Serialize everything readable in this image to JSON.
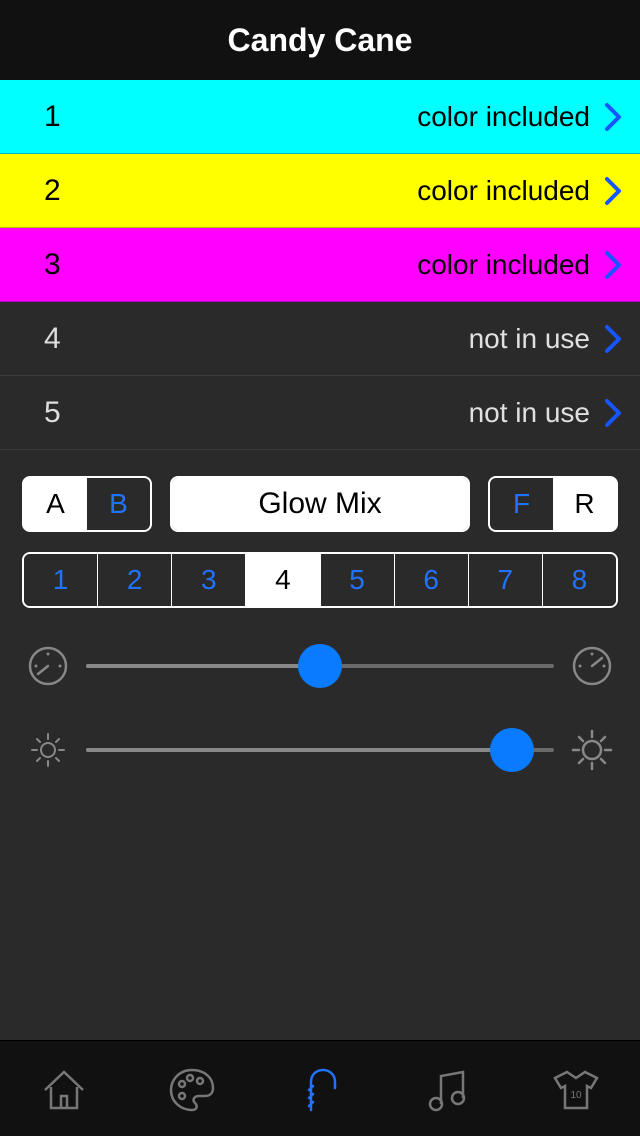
{
  "header": {
    "title": "Candy Cane"
  },
  "colors": {
    "included_label": "color included",
    "not_used_label": "not in use",
    "rows": [
      {
        "n": "1",
        "status": "color included",
        "bg": "#00FFFF",
        "fg": "#000000"
      },
      {
        "n": "2",
        "status": "color included",
        "bg": "#FFFF00",
        "fg": "#000000"
      },
      {
        "n": "3",
        "status": "color included",
        "bg": "#FF00FF",
        "fg": "#000000"
      },
      {
        "n": "4",
        "status": "not in use",
        "bg": "",
        "fg": ""
      },
      {
        "n": "5",
        "status": "not in use",
        "bg": "",
        "fg": ""
      }
    ]
  },
  "segments": {
    "ab": {
      "a": "A",
      "b": "B",
      "selected": "B"
    },
    "mode_label": "Glow Mix",
    "fr": {
      "f": "F",
      "r": "R",
      "selected": "F"
    },
    "numbers": [
      "1",
      "2",
      "3",
      "4",
      "5",
      "6",
      "7",
      "8"
    ],
    "numbers_selected": "4"
  },
  "sliders": {
    "speed": 0.5,
    "brightness": 0.91
  },
  "accent": "#0a7aff",
  "tabs": {
    "items": [
      "home",
      "palette",
      "candy",
      "music",
      "jersey"
    ],
    "active": "candy"
  }
}
